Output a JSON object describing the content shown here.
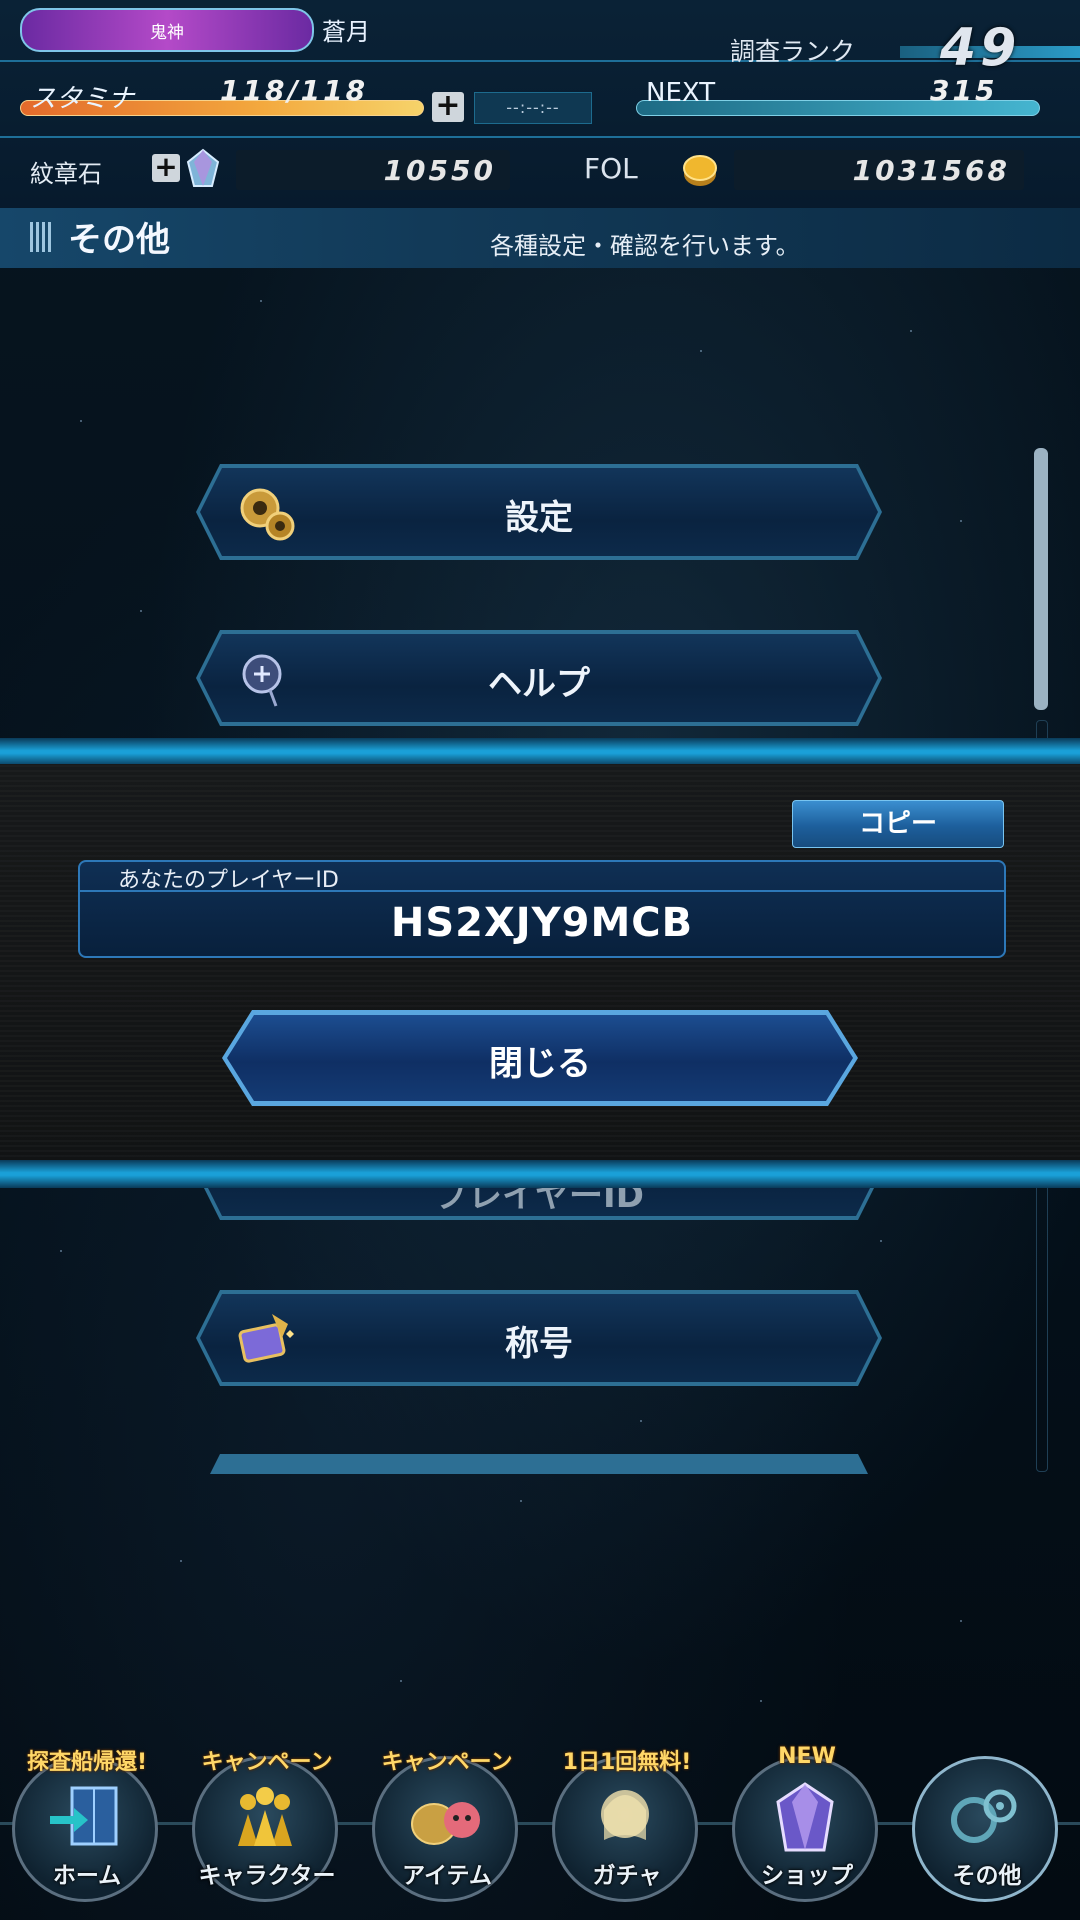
{
  "header": {
    "title_badge": "鬼神",
    "player_name": "蒼月",
    "rank_label": "調査ランク",
    "rank_value": "49",
    "stamina_label": "スタミナ",
    "stamina_value": "118/118",
    "stamina_timer": "--:--:--",
    "next_label": "NEXT",
    "next_value": "315",
    "crest_label": "紋章石",
    "crest_value": "10550",
    "fol_label": "FOL",
    "fol_value": "1031568"
  },
  "section": {
    "title": "その他",
    "description": "各種設定・確認を行います。"
  },
  "menu": {
    "items": [
      {
        "label": "設定",
        "icon": "gear-icon"
      },
      {
        "label": "ヘルプ",
        "icon": "help-icon"
      },
      {
        "label": "プレイヤーID",
        "icon": "id-icon"
      },
      {
        "label": "称号",
        "icon": "title-icon"
      }
    ]
  },
  "dialog": {
    "copy_label": "コピー",
    "id_label": "あなたのプレイヤーID",
    "id_value": "HS2XJY9MCB",
    "close_label": "閉じる"
  },
  "nav": {
    "items": [
      {
        "label": "ホーム",
        "badge": "探査船帰還!",
        "icon": "home-icon"
      },
      {
        "label": "キャラクター",
        "badge": "キャンペーン",
        "icon": "character-icon"
      },
      {
        "label": "アイテム",
        "badge": "キャンペーン",
        "icon": "item-icon"
      },
      {
        "label": "ガチャ",
        "badge": "1日1回無料!",
        "icon": "gacha-icon"
      },
      {
        "label": "ショップ",
        "badge": "NEW",
        "icon": "shop-icon"
      },
      {
        "label": "その他",
        "badge": "",
        "icon": "settings-icon"
      }
    ]
  },
  "colors": {
    "accent": "#1aa0d8",
    "button_border": "#2d6f94",
    "stamina_bar": "#f3a93e",
    "badge_text": "#ffd768"
  }
}
